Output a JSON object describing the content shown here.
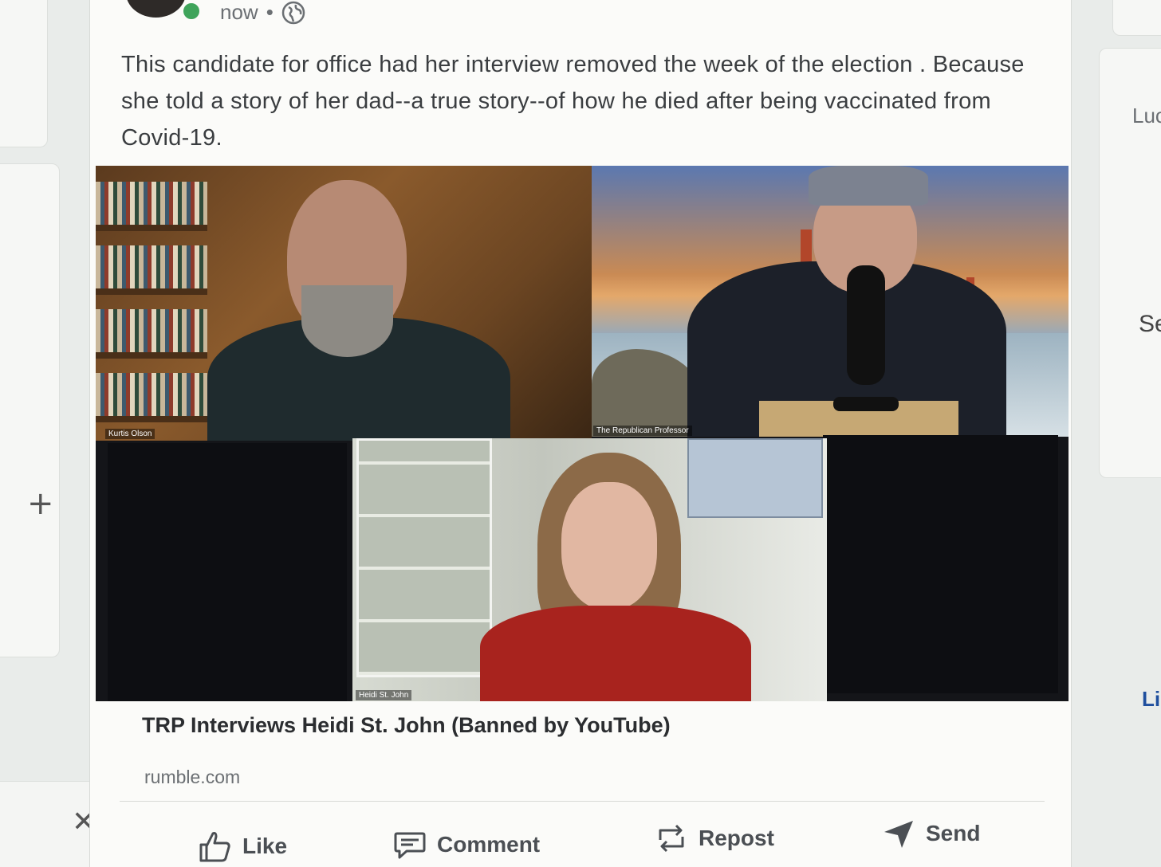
{
  "post": {
    "timestamp": "now",
    "separator": "•",
    "text": "This candidate for office had her interview removed the week of the election . Because she told a story of her dad--a true story--of how he died after being vaccinated from Covid-19.",
    "icons": {
      "visibility": "globe-icon",
      "status": "online-dot"
    }
  },
  "video": {
    "participants": [
      {
        "name": "Kurtis Olson"
      },
      {
        "name": "The Republican Professor"
      },
      {
        "name": "Heidi St. John"
      }
    ],
    "title": "TRP Interviews Heidi St. John (Banned by YouTube)",
    "domain": "rumble.com"
  },
  "actions": {
    "like": "Like",
    "comment": "Comment",
    "repost": "Repost",
    "send": "Send"
  },
  "sidebar_right": {
    "text_1": "Luc",
    "text_2": "Se",
    "link": "Li"
  },
  "left_rail": {
    "add_icon": "plus-icon",
    "close_icon": "close-icon"
  }
}
